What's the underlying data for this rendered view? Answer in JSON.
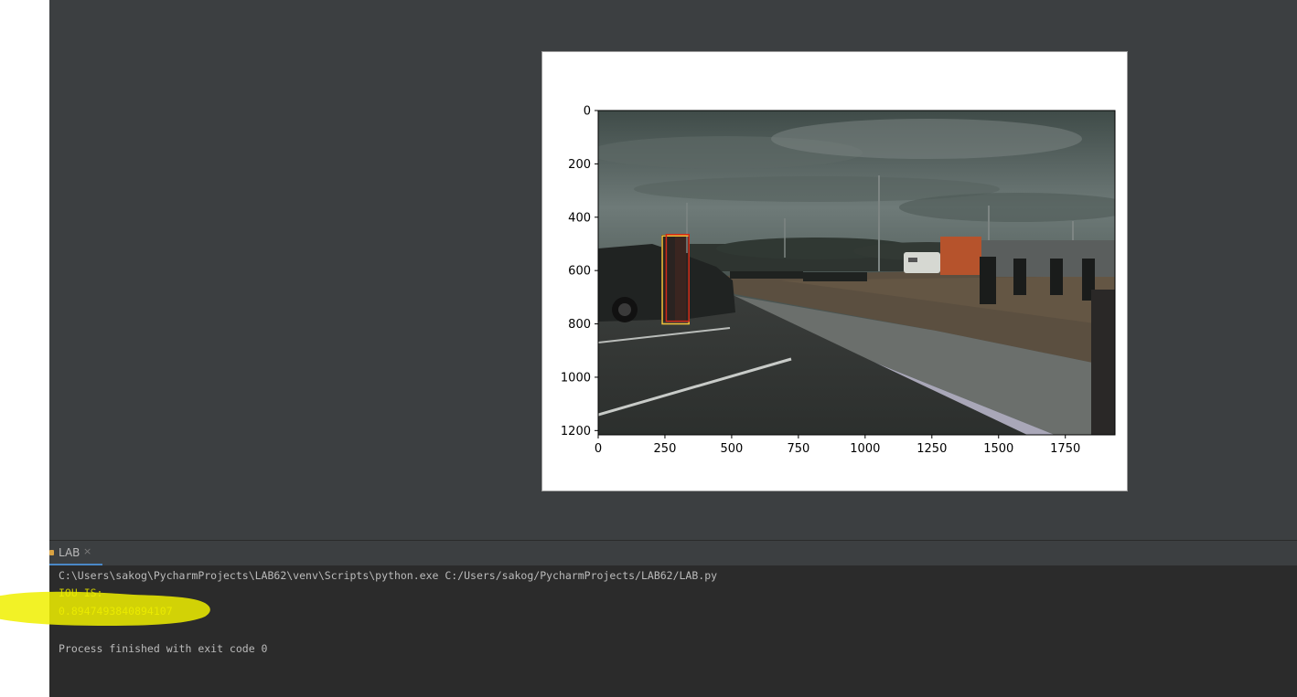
{
  "run_panel": {
    "tab_label": "LAB",
    "tab_close": "×"
  },
  "console": {
    "command": "C:\\Users\\sakog\\PycharmProjects\\LAB62\\venv\\Scripts\\python.exe C:/Users/sakog/PycharmProjects/LAB62/LAB.py",
    "output_label": "IOU IS:",
    "output_value": "0.8947493840894107",
    "exit_message": "Process finished with exit code 0"
  },
  "chart_data": {
    "type": "image",
    "x_ticks": [
      0,
      250,
      500,
      750,
      1000,
      1250,
      1500,
      1750
    ],
    "y_ticks": [
      0,
      200,
      400,
      600,
      800,
      1000,
      1200
    ],
    "xlim": [
      0,
      1936
    ],
    "ylim": [
      1216,
      0
    ],
    "boxes": [
      {
        "name": "yellow",
        "color": "#f2c23a",
        "x1": 240,
        "y1": 470,
        "x2": 340,
        "y2": 800
      },
      {
        "name": "red",
        "color": "#d02818",
        "x1": 255,
        "y1": 465,
        "x2": 340,
        "y2": 790
      }
    ]
  },
  "colors": {
    "ide_bg": "#3c3f41",
    "console_bg": "#2b2b2b",
    "console_text": "#bbbbbb",
    "output_text": "#c8c800",
    "highlight": "#f0f000"
  }
}
